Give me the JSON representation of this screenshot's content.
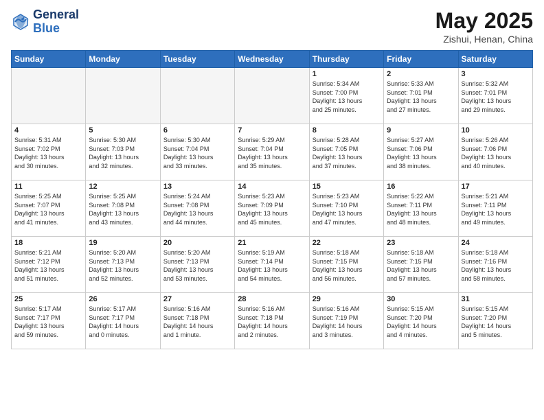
{
  "header": {
    "logo_line1": "General",
    "logo_line2": "Blue",
    "month_title": "May 2025",
    "subtitle": "Zishui, Henan, China"
  },
  "weekdays": [
    "Sunday",
    "Monday",
    "Tuesday",
    "Wednesday",
    "Thursday",
    "Friday",
    "Saturday"
  ],
  "weeks": [
    [
      {
        "day": "",
        "info": ""
      },
      {
        "day": "",
        "info": ""
      },
      {
        "day": "",
        "info": ""
      },
      {
        "day": "",
        "info": ""
      },
      {
        "day": "1",
        "info": "Sunrise: 5:34 AM\nSunset: 7:00 PM\nDaylight: 13 hours\nand 25 minutes."
      },
      {
        "day": "2",
        "info": "Sunrise: 5:33 AM\nSunset: 7:01 PM\nDaylight: 13 hours\nand 27 minutes."
      },
      {
        "day": "3",
        "info": "Sunrise: 5:32 AM\nSunset: 7:01 PM\nDaylight: 13 hours\nand 29 minutes."
      }
    ],
    [
      {
        "day": "4",
        "info": "Sunrise: 5:31 AM\nSunset: 7:02 PM\nDaylight: 13 hours\nand 30 minutes."
      },
      {
        "day": "5",
        "info": "Sunrise: 5:30 AM\nSunset: 7:03 PM\nDaylight: 13 hours\nand 32 minutes."
      },
      {
        "day": "6",
        "info": "Sunrise: 5:30 AM\nSunset: 7:04 PM\nDaylight: 13 hours\nand 33 minutes."
      },
      {
        "day": "7",
        "info": "Sunrise: 5:29 AM\nSunset: 7:04 PM\nDaylight: 13 hours\nand 35 minutes."
      },
      {
        "day": "8",
        "info": "Sunrise: 5:28 AM\nSunset: 7:05 PM\nDaylight: 13 hours\nand 37 minutes."
      },
      {
        "day": "9",
        "info": "Sunrise: 5:27 AM\nSunset: 7:06 PM\nDaylight: 13 hours\nand 38 minutes."
      },
      {
        "day": "10",
        "info": "Sunrise: 5:26 AM\nSunset: 7:06 PM\nDaylight: 13 hours\nand 40 minutes."
      }
    ],
    [
      {
        "day": "11",
        "info": "Sunrise: 5:25 AM\nSunset: 7:07 PM\nDaylight: 13 hours\nand 41 minutes."
      },
      {
        "day": "12",
        "info": "Sunrise: 5:25 AM\nSunset: 7:08 PM\nDaylight: 13 hours\nand 43 minutes."
      },
      {
        "day": "13",
        "info": "Sunrise: 5:24 AM\nSunset: 7:08 PM\nDaylight: 13 hours\nand 44 minutes."
      },
      {
        "day": "14",
        "info": "Sunrise: 5:23 AM\nSunset: 7:09 PM\nDaylight: 13 hours\nand 45 minutes."
      },
      {
        "day": "15",
        "info": "Sunrise: 5:23 AM\nSunset: 7:10 PM\nDaylight: 13 hours\nand 47 minutes."
      },
      {
        "day": "16",
        "info": "Sunrise: 5:22 AM\nSunset: 7:11 PM\nDaylight: 13 hours\nand 48 minutes."
      },
      {
        "day": "17",
        "info": "Sunrise: 5:21 AM\nSunset: 7:11 PM\nDaylight: 13 hours\nand 49 minutes."
      }
    ],
    [
      {
        "day": "18",
        "info": "Sunrise: 5:21 AM\nSunset: 7:12 PM\nDaylight: 13 hours\nand 51 minutes."
      },
      {
        "day": "19",
        "info": "Sunrise: 5:20 AM\nSunset: 7:13 PM\nDaylight: 13 hours\nand 52 minutes."
      },
      {
        "day": "20",
        "info": "Sunrise: 5:20 AM\nSunset: 7:13 PM\nDaylight: 13 hours\nand 53 minutes."
      },
      {
        "day": "21",
        "info": "Sunrise: 5:19 AM\nSunset: 7:14 PM\nDaylight: 13 hours\nand 54 minutes."
      },
      {
        "day": "22",
        "info": "Sunrise: 5:18 AM\nSunset: 7:15 PM\nDaylight: 13 hours\nand 56 minutes."
      },
      {
        "day": "23",
        "info": "Sunrise: 5:18 AM\nSunset: 7:15 PM\nDaylight: 13 hours\nand 57 minutes."
      },
      {
        "day": "24",
        "info": "Sunrise: 5:18 AM\nSunset: 7:16 PM\nDaylight: 13 hours\nand 58 minutes."
      }
    ],
    [
      {
        "day": "25",
        "info": "Sunrise: 5:17 AM\nSunset: 7:17 PM\nDaylight: 13 hours\nand 59 minutes."
      },
      {
        "day": "26",
        "info": "Sunrise: 5:17 AM\nSunset: 7:17 PM\nDaylight: 14 hours\nand 0 minutes."
      },
      {
        "day": "27",
        "info": "Sunrise: 5:16 AM\nSunset: 7:18 PM\nDaylight: 14 hours\nand 1 minute."
      },
      {
        "day": "28",
        "info": "Sunrise: 5:16 AM\nSunset: 7:18 PM\nDaylight: 14 hours\nand 2 minutes."
      },
      {
        "day": "29",
        "info": "Sunrise: 5:16 AM\nSunset: 7:19 PM\nDaylight: 14 hours\nand 3 minutes."
      },
      {
        "day": "30",
        "info": "Sunrise: 5:15 AM\nSunset: 7:20 PM\nDaylight: 14 hours\nand 4 minutes."
      },
      {
        "day": "31",
        "info": "Sunrise: 5:15 AM\nSunset: 7:20 PM\nDaylight: 14 hours\nand 5 minutes."
      }
    ]
  ]
}
